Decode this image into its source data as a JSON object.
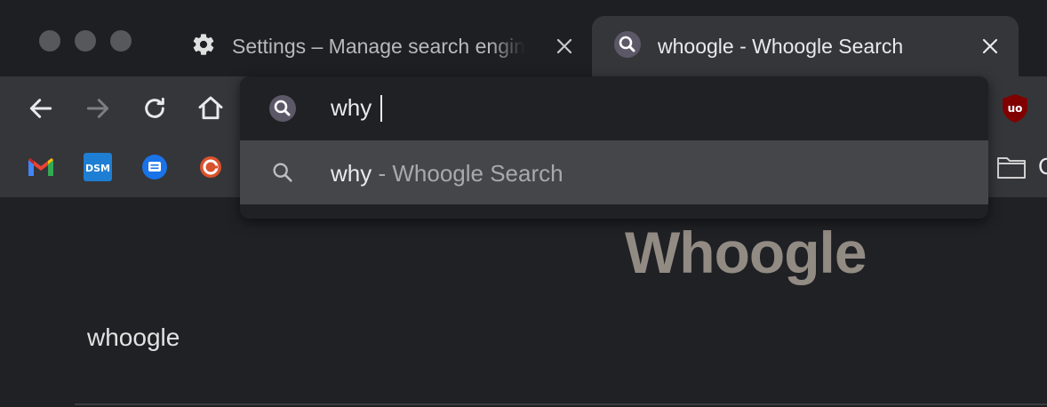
{
  "tabs": [
    {
      "title": "Settings – Manage search engines",
      "icon": "gear-icon",
      "active": false
    },
    {
      "title": "whoogle - Whoogle Search",
      "icon": "whoogle-icon",
      "active": true
    }
  ],
  "toolbar": {
    "icons": [
      "back-icon",
      "forward-icon",
      "reload-icon",
      "home-icon",
      "ublock-icon"
    ]
  },
  "bookmarks": {
    "icons": [
      "gmail-icon",
      "dsm-icon",
      "messages-icon",
      "grafana-icon",
      "folder-icon"
    ],
    "dsm_label": "DSM",
    "truncated_label": "C"
  },
  "omnibox": {
    "input_value": "why",
    "suggestion": {
      "query": "why",
      "separator": " - ",
      "description": "Whoogle Search"
    }
  },
  "page": {
    "logo": "Whoogle",
    "side_label": "whoogle"
  },
  "colors": {
    "tab_active_bg": "#35363a",
    "dropdown_bg": "#202124",
    "suggestion_highlight": "#454649",
    "logo": "#928b84"
  }
}
